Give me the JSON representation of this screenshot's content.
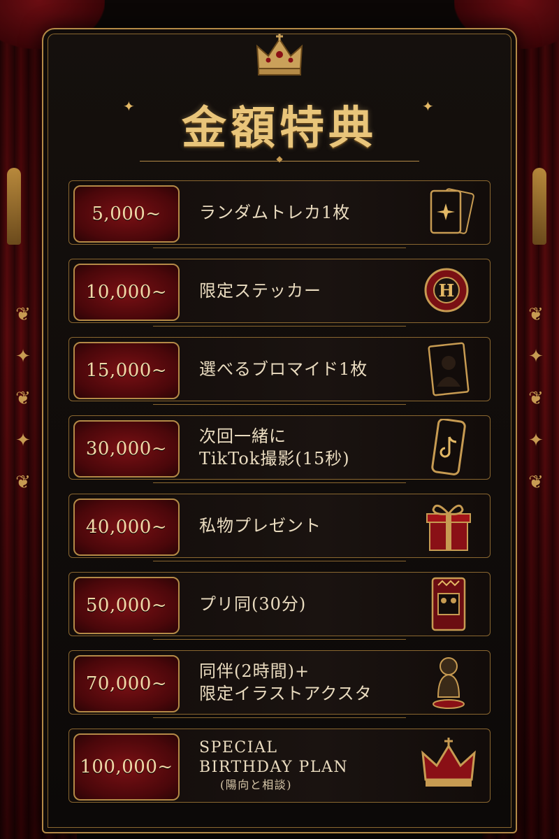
{
  "title": "金額特典",
  "tiers": [
    {
      "amount": "5,000~",
      "lines": [
        "ランダムトレカ1枚"
      ],
      "icon": "trading-cards-icon"
    },
    {
      "amount": "10,000~",
      "lines": [
        "限定ステッカー"
      ],
      "icon": "sticker-icon"
    },
    {
      "amount": "15,000~",
      "lines": [
        "選べるブロマイド1枚"
      ],
      "icon": "bromide-photo-icon"
    },
    {
      "amount": "30,000~",
      "lines": [
        "次回一緒に",
        "TikTok撮影(15秒)"
      ],
      "icon": "tiktok-phone-icon"
    },
    {
      "amount": "40,000~",
      "lines": [
        "私物プレゼント"
      ],
      "icon": "gift-box-icon"
    },
    {
      "amount": "50,000~",
      "lines": [
        "プリ同(30分)"
      ],
      "icon": "photo-booth-card-icon"
    },
    {
      "amount": "70,000~",
      "lines": [
        "同伴(2時間)+",
        "限定イラストアクスタ"
      ],
      "icon": "acrylic-stand-icon"
    },
    {
      "amount": "100,000~",
      "lines": [
        "SPECIAL",
        "BIRTHDAY PLAN"
      ],
      "sub": "(陽向と相談)",
      "icon": "crown-icon"
    }
  ],
  "colors": {
    "gold": "#c79b52",
    "red": "#7a1014",
    "background": "#0b0706"
  }
}
